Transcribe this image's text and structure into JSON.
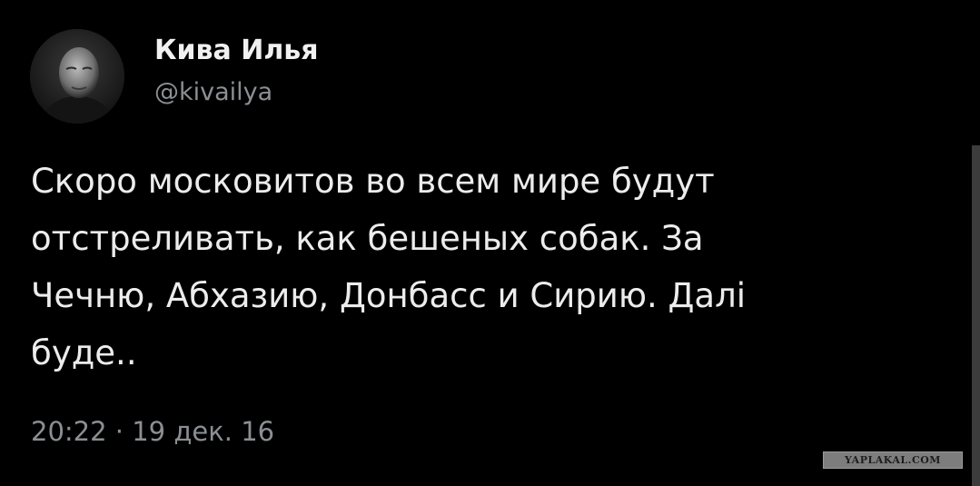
{
  "author": {
    "display_name": "Кива Илья",
    "handle": "@kivailya",
    "avatar_icon": "person-portrait-avatar"
  },
  "tweet": {
    "lines": [
      "Скоро московитов во всем мире будут",
      "отстреливать, как бешеных собак. За",
      "Чечню, Абхазию, Донбасс и Сирию. Далі",
      "буде.."
    ],
    "timestamp": "20:22 · 19 дек. 16"
  },
  "watermark": {
    "text": "YAPLAKAL.COM"
  },
  "colors": {
    "background": "#000000",
    "primary_text": "#e7e9ea",
    "secondary_text": "#8b8f93"
  }
}
